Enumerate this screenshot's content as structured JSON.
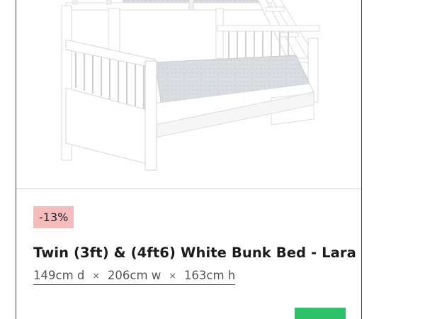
{
  "product": {
    "discount": "-13%",
    "title": "Twin (3ft) & (4ft6) White Bunk Bed - Lara",
    "dimensions": {
      "depth": "149cm d",
      "width": "206cm w",
      "height": "163cm h",
      "separator": "×"
    }
  },
  "colors": {
    "badge_bg": "#f6bcbc",
    "cta_button": "#2dc36a",
    "card_border": "#3a3a3a"
  },
  "icons": {
    "product_image": "white-bunk-bed-image"
  }
}
